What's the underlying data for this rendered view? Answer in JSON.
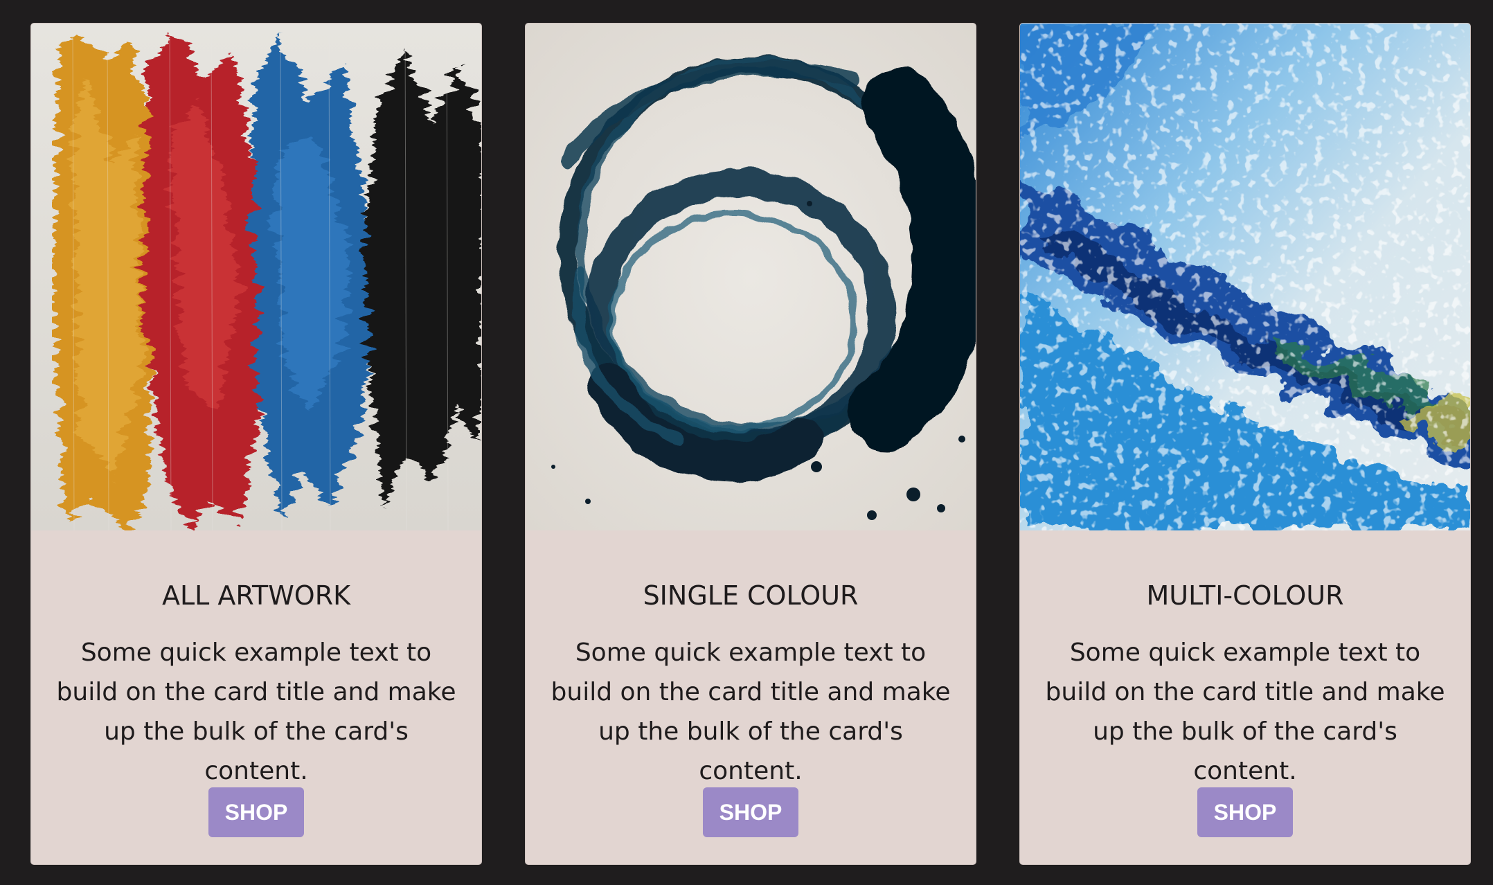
{
  "cards": [
    {
      "title": "ALL ARTWORK",
      "text": "Some quick example text to build on the card title and make up the bulk of the card's content.",
      "button_label": "SHOP",
      "image": "abstract-vertical-brushstrokes-yellow-red-blue-black"
    },
    {
      "title": "SINGLE COLOUR",
      "text": "Some quick example text to build on the card title and make up the bulk of the card's content.",
      "button_label": "SHOP",
      "image": "dark-teal-circular-brush-swirl"
    },
    {
      "title": "MULTI-COLOUR",
      "text": "Some quick example text to build on the card title and make up the bulk of the card's content.",
      "button_label": "SHOP",
      "image": "blue-textured-abstract-wave"
    }
  ],
  "colors": {
    "page_background": "#1f1d1e",
    "card_background": "#e2d5d1",
    "button_background": "#9b89c7",
    "button_text": "#ffffff",
    "title_text": "#1e1b1c"
  }
}
